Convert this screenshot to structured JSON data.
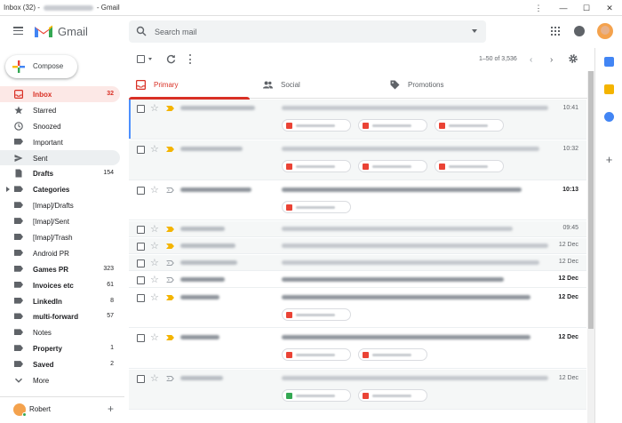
{
  "window": {
    "title_prefix": "Inbox (32) -",
    "title_suffix": "- Gmail",
    "minimize": "—",
    "maximize": "☐",
    "close": "✕",
    "menu": "⋮"
  },
  "header": {
    "logo_text": "Gmail",
    "search_placeholder": "Search mail"
  },
  "compose": {
    "label": "Compose"
  },
  "sidebar": {
    "items": [
      {
        "label": "Inbox",
        "count": "32",
        "icon": "inbox-icon",
        "bold": true
      },
      {
        "label": "Starred",
        "count": "",
        "icon": "star-icon"
      },
      {
        "label": "Snoozed",
        "count": "",
        "icon": "clock-icon"
      },
      {
        "label": "Important",
        "count": "",
        "icon": "important-icon"
      },
      {
        "label": "Sent",
        "count": "",
        "icon": "send-icon"
      },
      {
        "label": "Drafts",
        "count": "154",
        "icon": "draft-icon",
        "bold": true
      },
      {
        "label": "Categories",
        "count": "",
        "icon": "label-icon",
        "bold": true
      },
      {
        "label": "[Imap]/Drafts",
        "count": "",
        "icon": "label-icon"
      },
      {
        "label": "[Imap]/Sent",
        "count": "",
        "icon": "label-icon"
      },
      {
        "label": "[Imap]/Trash",
        "count": "",
        "icon": "label-icon"
      },
      {
        "label": "Android PR",
        "count": "",
        "icon": "label-icon"
      },
      {
        "label": "Games PR",
        "count": "323",
        "icon": "label-icon",
        "bold": true
      },
      {
        "label": "Invoices etc",
        "count": "61",
        "icon": "label-icon",
        "bold": true
      },
      {
        "label": "LinkedIn",
        "count": "8",
        "icon": "label-icon",
        "bold": true
      },
      {
        "label": "multi-forward",
        "count": "57",
        "icon": "label-icon",
        "bold": true
      },
      {
        "label": "Notes",
        "count": "",
        "icon": "label-icon"
      },
      {
        "label": "Property",
        "count": "1",
        "icon": "label-icon",
        "bold": true
      },
      {
        "label": "Saved",
        "count": "2",
        "icon": "label-icon",
        "bold": true
      },
      {
        "label": "More",
        "count": "",
        "icon": "chevron-down-icon"
      }
    ]
  },
  "user": {
    "name": "Robert",
    "add": "+"
  },
  "toolbar": {
    "range": "1–50 of 3,536",
    "prev": "‹",
    "next": "›"
  },
  "tabs": [
    {
      "label": "Primary",
      "icon": "inbox-tab-icon"
    },
    {
      "label": "Social",
      "icon": "people-icon"
    },
    {
      "label": "Promotions",
      "icon": "tag-icon"
    }
  ],
  "emails": [
    {
      "date": "10:41",
      "unread": false,
      "important": true
    },
    {
      "date": "10:32",
      "unread": false,
      "important": true
    },
    {
      "date": "10:13",
      "unread": true,
      "important": false
    },
    {
      "date": "09:45",
      "unread": false,
      "important": true
    },
    {
      "date": "12 Dec",
      "unread": false,
      "important": true
    },
    {
      "date": "12 Dec",
      "unread": false,
      "important": false
    },
    {
      "date": "12 Dec",
      "unread": true,
      "important": false
    },
    {
      "date": "12 Dec",
      "unread": true,
      "important": true
    },
    {
      "date": "12 Dec",
      "unread": true,
      "important": true
    },
    {
      "date": "12 Dec",
      "unread": false,
      "important": false
    }
  ],
  "colors": {
    "accent": "#d93025",
    "important": "#f4b400",
    "selected_edge": "#4d90fe"
  }
}
